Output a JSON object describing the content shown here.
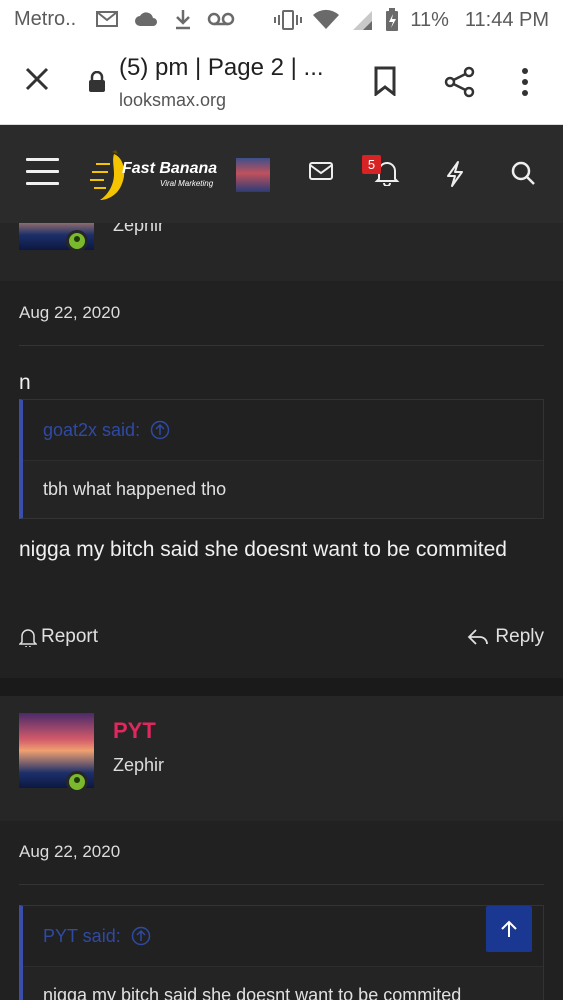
{
  "status_bar": {
    "carrier": "Metro..",
    "battery": "11%",
    "time": "11:44 PM"
  },
  "browser": {
    "tab_title": "(5) pm | Page 2 | ...",
    "url": "looksmax.org"
  },
  "site_nav": {
    "logo_brand": "Fast Banana",
    "logo_tagline": "Viral Marketing",
    "notification_count": "5"
  },
  "posts": [
    {
      "user_title": "Zephir",
      "date": "Aug 22, 2020",
      "first_line": "n",
      "quote": {
        "author": "goat2x said:",
        "text": "tbh what happened tho"
      },
      "message": "nigga my bitch said she doesnt want to be commited",
      "actions": {
        "report": "Report",
        "reply": "Reply"
      }
    },
    {
      "username": "PYT",
      "user_title": "Zephir",
      "date": "Aug 22, 2020",
      "quote": {
        "author": "PYT said:",
        "text": "nigga my bitch said she doesnt want to be commited"
      }
    }
  ],
  "colors": {
    "accent_pink": "#e0275e",
    "quote_link_blue": "#2f4aa3",
    "online_green": "#7ab82d",
    "scroll_top_bg": "#1a3791"
  }
}
